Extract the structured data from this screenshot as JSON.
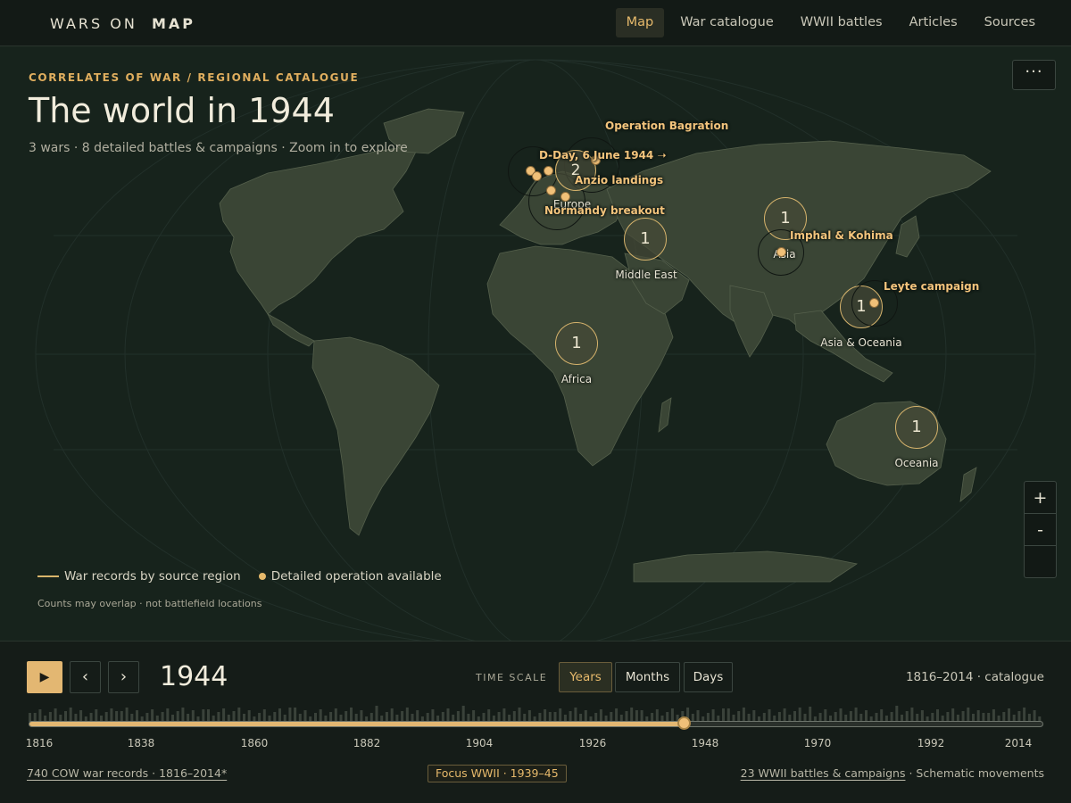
{
  "brand": {
    "prefix": "WARS ON",
    "bold": "MAP"
  },
  "nav": [
    {
      "label": "Map",
      "active": true
    },
    {
      "label": "War catalogue",
      "active": false
    },
    {
      "label": "WWII battles",
      "active": false
    },
    {
      "label": "Articles",
      "active": false
    },
    {
      "label": "Sources",
      "active": false
    }
  ],
  "map": {
    "kicker": "CORRELATES OF WAR / REGIONAL CATALOGUE",
    "title": "The world in 1944",
    "subtitle": "3 wars · 8 detailed battles & campaigns · Zoom in to explore",
    "more_label": "···",
    "zoom_in": "+",
    "zoom_out": "-",
    "legend_line": "War records by source region",
    "legend_dot": "Detailed operation available",
    "note": "Counts may overlap · not battlefield locations",
    "regions": [
      {
        "label": "Middle East",
        "count": "1"
      },
      {
        "label": "Africa",
        "count": "1"
      },
      {
        "label": "Asia",
        "count": "1"
      },
      {
        "label": "Asia & Oceania",
        "count": "1"
      },
      {
        "label": "Oceania",
        "count": "1"
      },
      {
        "label": "Europe",
        "count": "2"
      }
    ],
    "operations": [
      "Operation Bagration",
      "D-Day, 6 June 1944 ➝",
      "Anzio landings",
      "Normandy breakout",
      "Imphal & Kohima",
      "Leyte campaign"
    ],
    "colors": {
      "accent": "#e3b772",
      "land": "#3a4535",
      "ocean": "#17231c"
    }
  },
  "timeline": {
    "play_icon": "play-icon",
    "play_glyph": "▶",
    "prev_glyph": "‹",
    "next_glyph": "›",
    "year": "1944",
    "time_scale_label": "TIME SCALE",
    "scales": [
      "Years",
      "Months",
      "Days"
    ],
    "active_scale": "Years",
    "range_note": "1816–2014 · catalogue",
    "start_year": 1816,
    "end_year": 2014,
    "current_year": 1944,
    "ticks": [
      "1816",
      "1838",
      "1860",
      "1882",
      "1904",
      "1926",
      "1948",
      "1970",
      "1992",
      "2014"
    ],
    "footer_left": "740 COW war records · 1816–2014*",
    "focus_badge": "Focus WWII · 1939–45",
    "footer_right_link": "23 WWII battles & campaigns",
    "footer_right_rest": " · Schematic movements"
  }
}
